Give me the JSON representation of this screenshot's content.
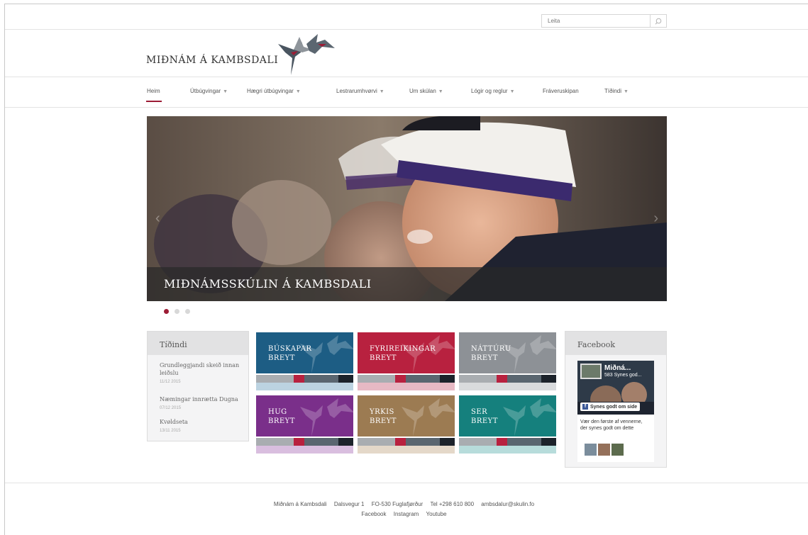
{
  "search": {
    "placeholder": "Leita",
    "icon": "search-icon"
  },
  "logo": {
    "text": "MIÐNÁM Á KAMBSDALI"
  },
  "nav": [
    {
      "label": "Heim",
      "dropdown": false,
      "active": true
    },
    {
      "label": "Útbúgvingar",
      "dropdown": true
    },
    {
      "label": "Hægri útbúgvingar",
      "dropdown": true
    },
    {
      "label": "Lestrarumhvørvi",
      "dropdown": true
    },
    {
      "label": "Um skúlan",
      "dropdown": true
    },
    {
      "label": "Lógir og reglur",
      "dropdown": true
    },
    {
      "label": "Fráveruskipan",
      "dropdown": false
    },
    {
      "label": "Tíðindi",
      "dropdown": true
    }
  ],
  "hero": {
    "caption": "MIÐNÁMSSKÚLIN Á KAMBSDALI",
    "slide_index": 1,
    "slide_count": 3
  },
  "news": {
    "title": "Tíðindi",
    "items": [
      {
        "title": "Grundleggjandi skeið innan leiðslu",
        "date": "11/12 2015"
      },
      {
        "title": "Næmingar innrætta Dugna",
        "date": "07/12 2015"
      },
      {
        "title": "Kvøldseta",
        "date": "13/11 2015"
      }
    ]
  },
  "tiles": [
    {
      "line1": "BÚSKAPAR",
      "line2": "BREYT",
      "color": "#1d5d84",
      "light": "#bcd3e1"
    },
    {
      "line1": "FYRIREIKINGAR",
      "line2": "BREYT",
      "color": "#b8213f",
      "light": "#e7b9c4"
    },
    {
      "line1": "NÁTTÚRU",
      "line2": "BREYT",
      "color": "#8d9196",
      "light": "#d9dbdd"
    },
    {
      "line1": "HUG",
      "line2": "BREYT",
      "color": "#7a2f8a",
      "light": "#d9bedf"
    },
    {
      "line1": "YRKIS",
      "line2": "BREYT",
      "color": "#9c7b52",
      "light": "#e4d8c9"
    },
    {
      "line1": "SER",
      "line2": "BREYT",
      "color": "#15807d",
      "light": "#b7dcdb"
    }
  ],
  "facebook": {
    "title": "Facebook",
    "page_name": "Miðná...",
    "likes": "583 Synes god...",
    "like_button": "Synes godt om side",
    "prompt": "Vær den første af vennerne, der synes godt om dette"
  },
  "footer": {
    "name": "Miðnám á Kambsdali",
    "street": "Dalsvegur 1",
    "city": "FO-530 Fuglafjørður",
    "phone": "Tel +298 610 800",
    "email": "ambsdalur@skulin.fo",
    "links": [
      "Facebook",
      "Instagram",
      "Youtube"
    ]
  },
  "colors": {
    "accent": "#9c1c35",
    "tile_bar_red": "#b8213f",
    "tile_bar_slate": "#5a6670",
    "tile_bar_dark": "#1c232b",
    "tile_bar_gray": "#a9adb1"
  }
}
